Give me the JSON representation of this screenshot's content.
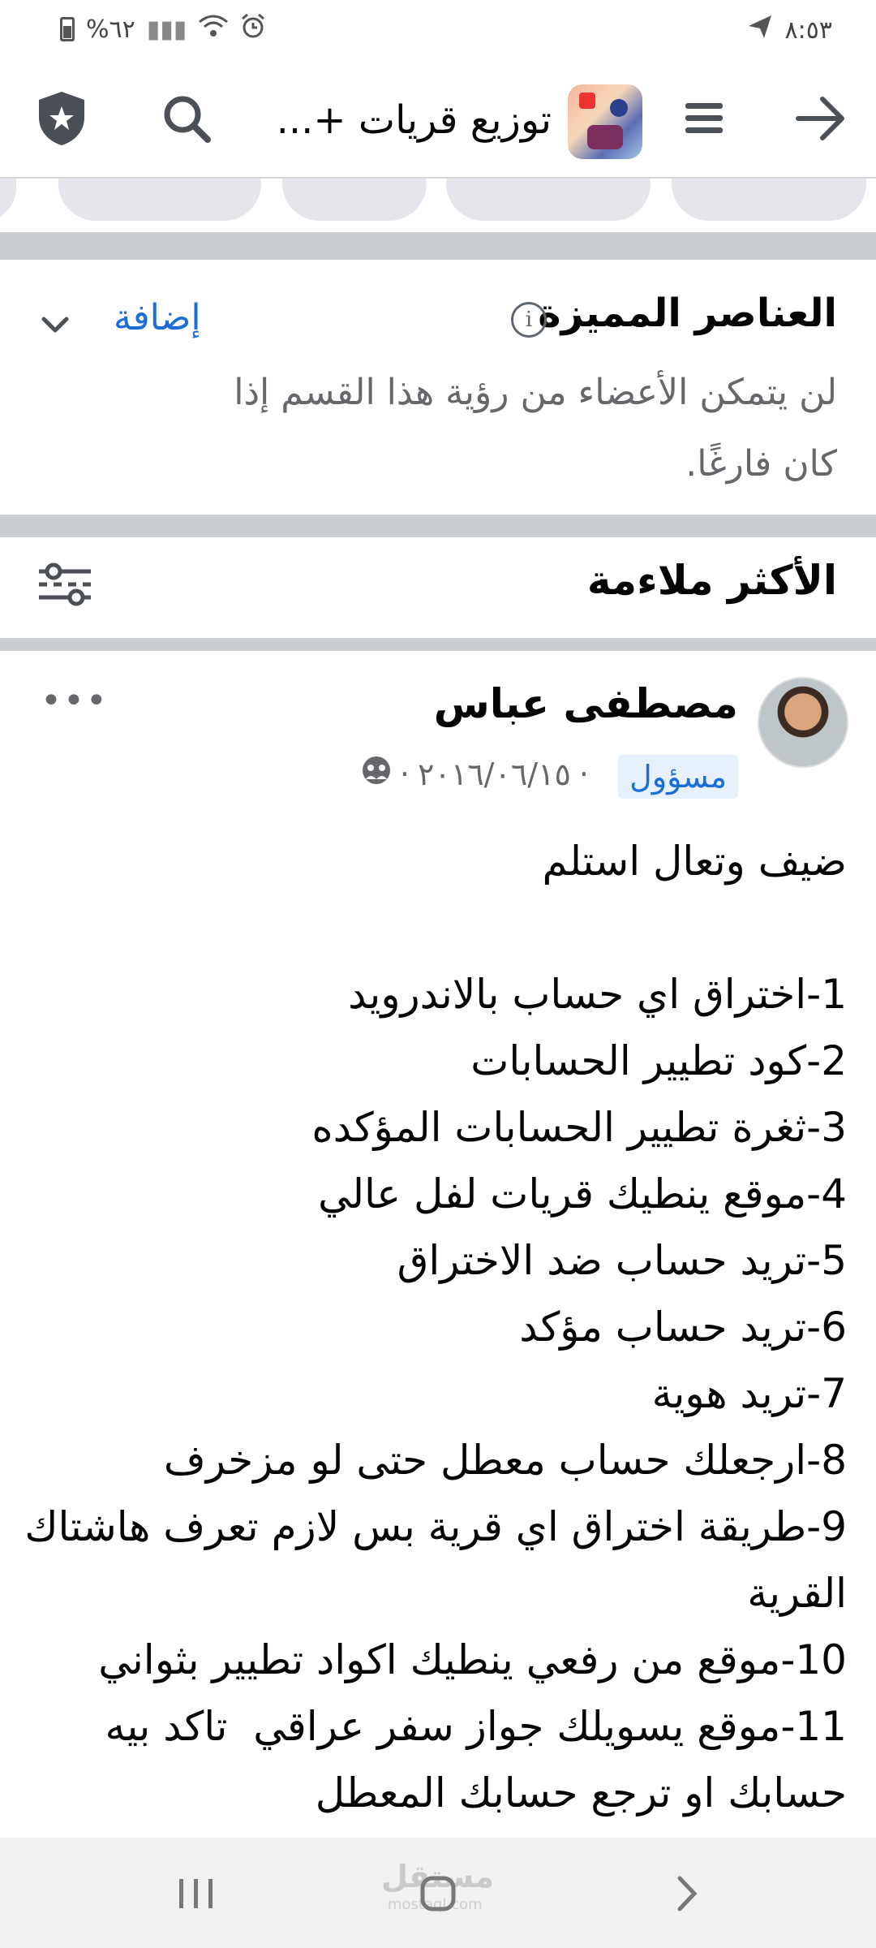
{
  "status_bar": {
    "time": "٨:٥٣",
    "battery": "%٦٢"
  },
  "header": {
    "group_title": "توزيع قريات +..."
  },
  "featured": {
    "title": "العناصر المميزة",
    "add_label": "إضافة",
    "description": "لن يتمكن الأعضاء من رؤية هذا القسم إذا كان فارغًا."
  },
  "sort": {
    "title": "الأكثر ملاءمة"
  },
  "post": {
    "author": "مصطفى عباس",
    "role": "مسؤول",
    "date": "٢٠١٦/٠٦/١٥",
    "separator": "·",
    "more": "•••",
    "lines": [
      "ضيف وتعال استلم",
      "",
      "1-اختراق اي حساب بالاندرويد",
      "2-كود تطيير الحسابات",
      "3-ثغرة تطيير الحسابات المؤكده",
      "4-موقع ينطيك قريات لفل عالي",
      "5-تريد حساب ضد الاختراق",
      "6-تريد حساب مؤكد",
      "7-تريد هوية",
      "8-ارجعلك حساب معطل حتى لو مزخرف",
      "9-طريقة اختراق اي قرية بس لازم تعرف هاشتاك القرية",
      "10-موقع من رفعي ينطيك اكواد تطيير بثواني",
      "11-موقع يسويلك جواز سفر عراقي  تاكد بيه حسابك او ترجع حسابك المعطل"
    ]
  },
  "watermark": {
    "text": "مستقل",
    "sub": "mostaql.com"
  },
  "colors": {
    "link": "#1b6ed6",
    "divider": "#c9ccd1",
    "secondary_text": "#65676b"
  }
}
